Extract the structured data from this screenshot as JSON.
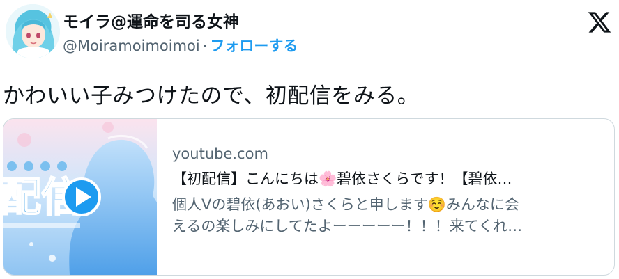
{
  "tweet": {
    "author": {
      "display_name": "モイラ@運命を司る女神",
      "handle": "@Moiramoimoimoi",
      "separator": "·",
      "follow_label": "フォローする"
    },
    "text": "かわいい子みつけたので、初配信をみる。"
  },
  "card": {
    "domain": "youtube.com",
    "title": "【初配信】こんにちは🌸碧依さくらです！【碧依…",
    "description_line1": "個人Vの碧依(あおい)さくらと申します☺️みんなに会",
    "description_line2": "えるの楽しみにしてたよーーーーー！！！来てくれ…",
    "thumbnail_text": "配信"
  },
  "icons": {
    "platform": "x-logo-icon",
    "play": "play-icon"
  },
  "colors": {
    "accent": "#1d9bf0",
    "secondary_text": "#536471",
    "border": "#cfd9de"
  }
}
